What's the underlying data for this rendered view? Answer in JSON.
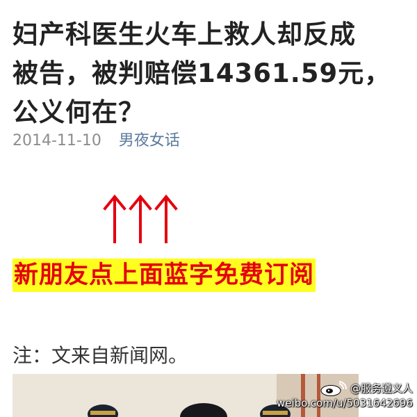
{
  "article": {
    "title_lines": [
      "妇产科医生火车上救人却反成",
      "被告，被判赔偿14361.59元，",
      "公义何在？"
    ],
    "date": "2014-11-10",
    "author": "男夜女话"
  },
  "subscribe": {
    "banner_text": "新朋友点上面蓝字免费订阅",
    "arrow_icon": "up-arrow-icon",
    "color": "#e4000f",
    "highlight": "#ffff1f"
  },
  "body": {
    "source_note": "注：文来自新闻网。"
  },
  "watermark": {
    "handle": "@服务遵义人",
    "url": "weibo.com/u/5031642696",
    "icon": "weibo-logo-icon"
  }
}
